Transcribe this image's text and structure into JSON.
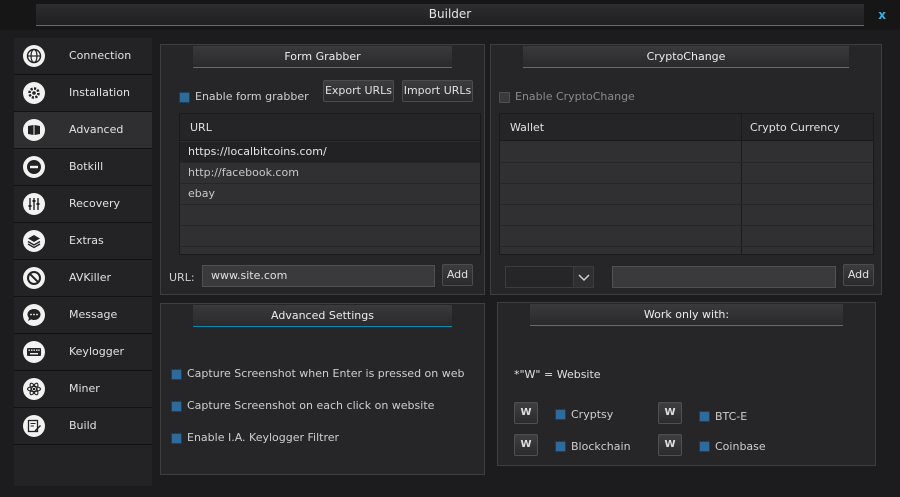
{
  "window": {
    "title": "Builder",
    "close_label": "x"
  },
  "sidebar": {
    "items": [
      {
        "label": "Connection",
        "icon": "globe-icon"
      },
      {
        "label": "Installation",
        "icon": "gear-icon"
      },
      {
        "label": "Advanced",
        "icon": "book-icon",
        "active": true
      },
      {
        "label": "Botkill",
        "icon": "minus-circle-icon"
      },
      {
        "label": "Recovery",
        "icon": "sliders-icon"
      },
      {
        "label": "Extras",
        "icon": "layers-icon"
      },
      {
        "label": "AVKiller",
        "icon": "block-icon"
      },
      {
        "label": "Message",
        "icon": "chat-bubble-icon"
      },
      {
        "label": "Keylogger",
        "icon": "keyboard-icon"
      },
      {
        "label": "Miner",
        "icon": "atom-icon"
      },
      {
        "label": "Build",
        "icon": "edit-icon"
      }
    ]
  },
  "form_grabber": {
    "title": "Form Grabber",
    "enable_label": "Enable form grabber",
    "export_label": "Export URLs",
    "import_label": "Import URLs",
    "column_header": "URL",
    "urls": [
      "https://localbitcoins.com/",
      "http://facebook.com",
      "ebay"
    ],
    "url_label": "URL:",
    "url_value": "www.site.com",
    "add_label": "Add"
  },
  "crypto_change": {
    "title": "CryptoChange",
    "enable_label": "Enable CryptoChange",
    "col_wallet": "Wallet",
    "col_currency": "Crypto Currency",
    "add_label": "Add"
  },
  "advanced_settings": {
    "title": "Advanced Settings",
    "options": [
      "Capture Screenshot when Enter is pressed on web",
      "Capture Screenshot on each click on website",
      "Enable I.A. Keylogger Filtrer"
    ]
  },
  "work_only": {
    "title": "Work only with:",
    "legend": "*\"W\" = Website",
    "w_label": "W",
    "items": [
      "Cryptsy",
      "BTC-E",
      "Blockchain",
      "Coinbase"
    ]
  },
  "colors": {
    "accent": "#0e8bb3",
    "checkbox": "#2e6a9a"
  }
}
